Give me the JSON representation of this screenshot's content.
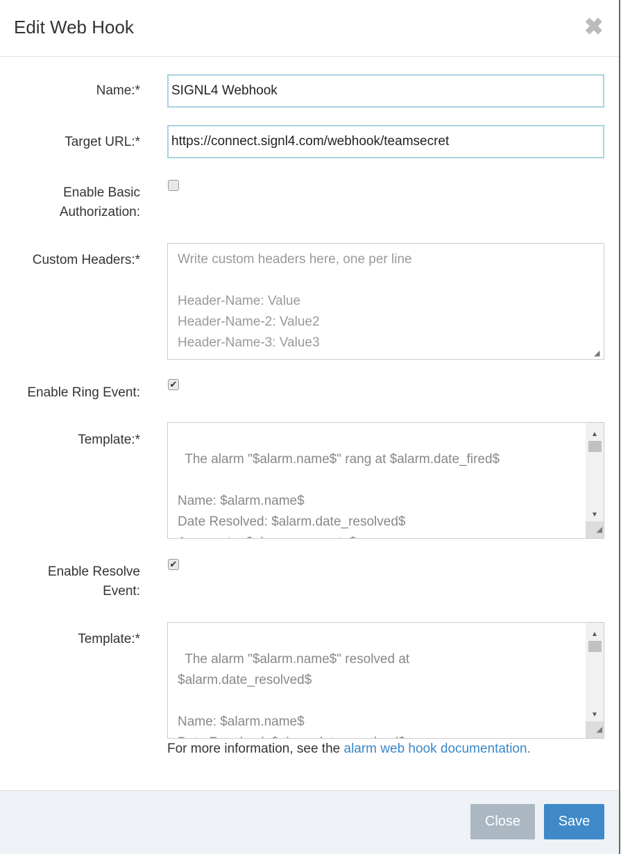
{
  "dialog": {
    "title": "Edit Web Hook",
    "close_icon": "close-icon"
  },
  "form": {
    "name": {
      "label": "Name:*",
      "value": "SIGNL4 Webhook"
    },
    "target_url": {
      "label": "Target URL:*",
      "value": "https://connect.signl4.com/webhook/teamsecret"
    },
    "basic_auth": {
      "label_line1": "Enable Basic",
      "label_line2": "Authorization:",
      "checked": false
    },
    "custom_headers": {
      "label": "Custom Headers:*",
      "placeholder": "Write custom headers here, one per line\n\nHeader-Name: Value\nHeader-Name-2: Value2\nHeader-Name-3: Value3"
    },
    "ring_event": {
      "label": "Enable Ring Event:",
      "checked": true
    },
    "ring_template": {
      "label": "Template:*",
      "value": "The alarm \"$alarm.name$\" rang at $alarm.date_fired$\n\nName: $alarm.name$\nDate Resolved: $alarm.date_resolved$\nAggregate: $alarm.aggregate$\nCondition: $alarm.condition$"
    },
    "resolve_event": {
      "label_line1": "Enable Resolve",
      "label_line2": "Event:",
      "checked": true
    },
    "resolve_template": {
      "label": "Template:*",
      "value": "The alarm \"$alarm.name$\" resolved at\n$alarm.date_resolved$\n\nName: $alarm.name$\nDate Resolved: $alarm.date_resolved$"
    },
    "info_text": "For more information, see the ",
    "info_link": "alarm web hook documentation."
  },
  "footer": {
    "close_label": "Close",
    "save_label": "Save"
  },
  "colors": {
    "primary": "#3f89c9",
    "disabled": "#abb8c2",
    "link": "#3a87c8",
    "input_focus_border": "#a8d3e0"
  }
}
